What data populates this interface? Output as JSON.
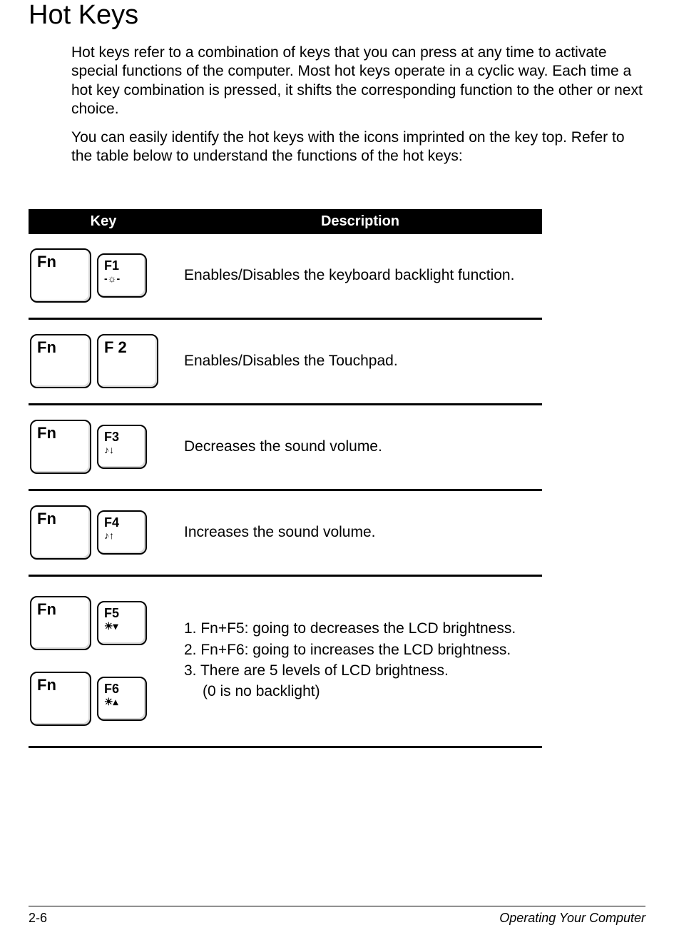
{
  "title": "Hot Keys",
  "para1": "Hot keys refer to a combination of keys that you can press at any time to activate special functions of the computer. Most hot keys operate in a cyclic way. Each time a hot key combination is pressed, it shifts the corresponding function to the other or next choice.",
  "para2": "You can easily identify the hot keys with the icons imprinted on the key top. Refer to the table below to understand the functions of the hot keys:",
  "table": {
    "header": {
      "key": "Key",
      "desc": "Description"
    },
    "rows": [
      {
        "keys": [
          {
            "label": "Fn",
            "size": "big"
          },
          {
            "label": "F1",
            "icon": "-☼-",
            "size": "small"
          }
        ],
        "desc": "Enables/Disables the keyboard backlight function."
      },
      {
        "keys": [
          {
            "label": "Fn",
            "size": "big"
          },
          {
            "label": "F 2",
            "size": "big"
          }
        ],
        "desc": "Enables/Disables the Touchpad."
      },
      {
        "keys": [
          {
            "label": "Fn",
            "size": "big"
          },
          {
            "label": "F3",
            "icon": "♪↓",
            "size": "small"
          }
        ],
        "desc": "Decreases the sound volume."
      },
      {
        "keys": [
          {
            "label": "Fn",
            "size": "big"
          },
          {
            "label": "F4",
            "icon": "♪↑",
            "size": "small"
          }
        ],
        "desc": "Increases the sound volume."
      },
      {
        "stacked": true,
        "keypairs": [
          [
            {
              "label": "Fn",
              "size": "big"
            },
            {
              "label": "F5",
              "icon": "☀▾",
              "size": "small"
            }
          ],
          [
            {
              "label": "Fn",
              "size": "big"
            },
            {
              "label": "F6",
              "icon": "☀▴",
              "size": "small"
            }
          ]
        ],
        "desc_lines": [
          "1. Fn+F5: going to decreases the LCD brightness.",
          "2. Fn+F6: going to increases the LCD brightness.",
          "3. There are 5 levels of LCD brightness.",
          "(0 is no backlight)"
        ]
      }
    ]
  },
  "footer": {
    "page": "2-6",
    "section": "Operating Your Computer"
  }
}
